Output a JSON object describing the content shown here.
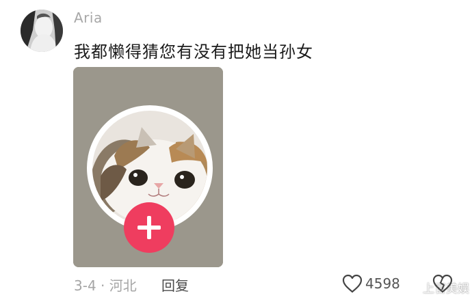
{
  "comment": {
    "username": "Aria",
    "text": "我都懒得猜您有没有把她当孙女",
    "date_location": "3-4 · 河北",
    "reply_label": "回复",
    "like_count": "4598"
  },
  "icons": {
    "avatar": "user-avatar",
    "like": "heart-outline-icon",
    "dislike": "broken-heart-outline-icon",
    "follow": "plus-icon",
    "watermark_logo": "weibo-logo-icon"
  },
  "watermark": {
    "text": "上官美娱"
  },
  "colors": {
    "card_bg": "#9b978c",
    "follow_button": "#ef3d5f",
    "text_primary": "#1a1a1a",
    "text_meta": "#a5a5a5"
  }
}
